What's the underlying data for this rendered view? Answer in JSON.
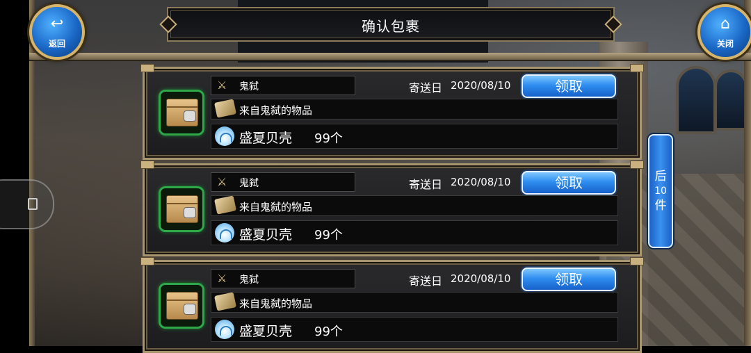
{
  "title": "确认包裹",
  "nav": {
    "back_label": "返回",
    "close_label": "关闭"
  },
  "page_button": {
    "prefix": "后",
    "count": "10",
    "suffix": "件"
  },
  "parcels": [
    {
      "sender": "鬼弑",
      "date_label": "寄送日",
      "date": "2020/08/10",
      "claim_label": "领取",
      "message": "来自鬼弑的物品",
      "item_name": "盛夏贝壳",
      "item_qty": "99个"
    },
    {
      "sender": "鬼弑",
      "date_label": "寄送日",
      "date": "2020/08/10",
      "claim_label": "领取",
      "message": "来自鬼弑的物品",
      "item_name": "盛夏贝壳",
      "item_qty": "99个"
    },
    {
      "sender": "鬼弑",
      "date_label": "寄送日",
      "date": "2020/08/10",
      "claim_label": "领取",
      "message": "来自鬼弑的物品",
      "item_name": "盛夏贝壳",
      "item_qty": "99个"
    }
  ],
  "colors": {
    "accent_blue": "#2f8ef0",
    "frame_gold": "#a8966f",
    "package_green": "#2fa84a"
  }
}
